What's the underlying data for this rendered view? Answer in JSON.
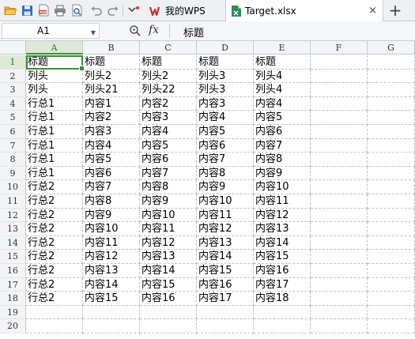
{
  "toolbar": {
    "icons": [
      "open-folder-icon",
      "save-icon",
      "export-pdf-icon",
      "print-icon",
      "print-preview-icon",
      "undo-icon",
      "redo-icon",
      "more-dropdown-icon"
    ]
  },
  "tabs": {
    "wps_label": "我的WPS",
    "file_label": "Target.xlsx",
    "close_glyph": "×",
    "new_tab_glyph": "+"
  },
  "formula_bar": {
    "cell_ref": "A1",
    "fx_label": "fx",
    "content": "标题"
  },
  "sheet": {
    "columns": [
      "A",
      "B",
      "C",
      "D",
      "E",
      "F",
      "G"
    ],
    "selected_column": "A",
    "selected_row": 1,
    "rows": [
      {
        "n": "1",
        "cells": [
          "标题",
          "标题",
          "标题",
          "标题",
          "标题",
          "",
          ""
        ]
      },
      {
        "n": "2",
        "cells": [
          "列头",
          "列头2",
          "列头2",
          "列头3",
          "列头4",
          "",
          ""
        ]
      },
      {
        "n": "3",
        "cells": [
          "列头",
          "列头21",
          "列头22",
          "列头3",
          "列头4",
          "",
          ""
        ]
      },
      {
        "n": "4",
        "cells": [
          "行总1",
          "内容1",
          "内容2",
          "内容3",
          "内容4",
          "",
          ""
        ]
      },
      {
        "n": "5",
        "cells": [
          "行总1",
          "内容2",
          "内容3",
          "内容4",
          "内容5",
          "",
          ""
        ]
      },
      {
        "n": "6",
        "cells": [
          "行总1",
          "内容3",
          "内容4",
          "内容5",
          "内容6",
          "",
          ""
        ]
      },
      {
        "n": "7",
        "cells": [
          "行总1",
          "内容4",
          "内容5",
          "内容6",
          "内容7",
          "",
          ""
        ]
      },
      {
        "n": "8",
        "cells": [
          "行总1",
          "内容5",
          "内容6",
          "内容7",
          "内容8",
          "",
          ""
        ]
      },
      {
        "n": "9",
        "cells": [
          "行总1",
          "内容6",
          "内容7",
          "内容8",
          "内容9",
          "",
          ""
        ]
      },
      {
        "n": "10",
        "cells": [
          "行总2",
          "内容7",
          "内容8",
          "内容9",
          "内容10",
          "",
          ""
        ]
      },
      {
        "n": "11",
        "cells": [
          "行总2",
          "内容8",
          "内容9",
          "内容10",
          "内容11",
          "",
          ""
        ]
      },
      {
        "n": "12",
        "cells": [
          "行总2",
          "内容9",
          "内容10",
          "内容11",
          "内容12",
          "",
          ""
        ]
      },
      {
        "n": "13",
        "cells": [
          "行总2",
          "内容10",
          "内容11",
          "内容12",
          "内容13",
          "",
          ""
        ]
      },
      {
        "n": "14",
        "cells": [
          "行总2",
          "内容11",
          "内容12",
          "内容13",
          "内容14",
          "",
          ""
        ]
      },
      {
        "n": "15",
        "cells": [
          "行总2",
          "内容12",
          "内容13",
          "内容14",
          "内容15",
          "",
          ""
        ]
      },
      {
        "n": "16",
        "cells": [
          "行总2",
          "内容13",
          "内容14",
          "内容15",
          "内容16",
          "",
          ""
        ]
      },
      {
        "n": "17",
        "cells": [
          "行总2",
          "内容14",
          "内容15",
          "内容16",
          "内容17",
          "",
          ""
        ]
      },
      {
        "n": "18",
        "cells": [
          "行总2",
          "内容15",
          "内容16",
          "内容17",
          "内容18",
          "",
          ""
        ]
      },
      {
        "n": "19",
        "cells": [
          "",
          "",
          "",
          "",
          "",
          "",
          ""
        ]
      },
      {
        "n": "20",
        "cells": [
          "",
          "",
          "",
          "",
          "",
          "",
          ""
        ]
      }
    ]
  },
  "colors": {
    "selection_green": "#3a8e3a",
    "wps_red": "#d32f2f",
    "xlsx_green": "#2e8b57"
  }
}
